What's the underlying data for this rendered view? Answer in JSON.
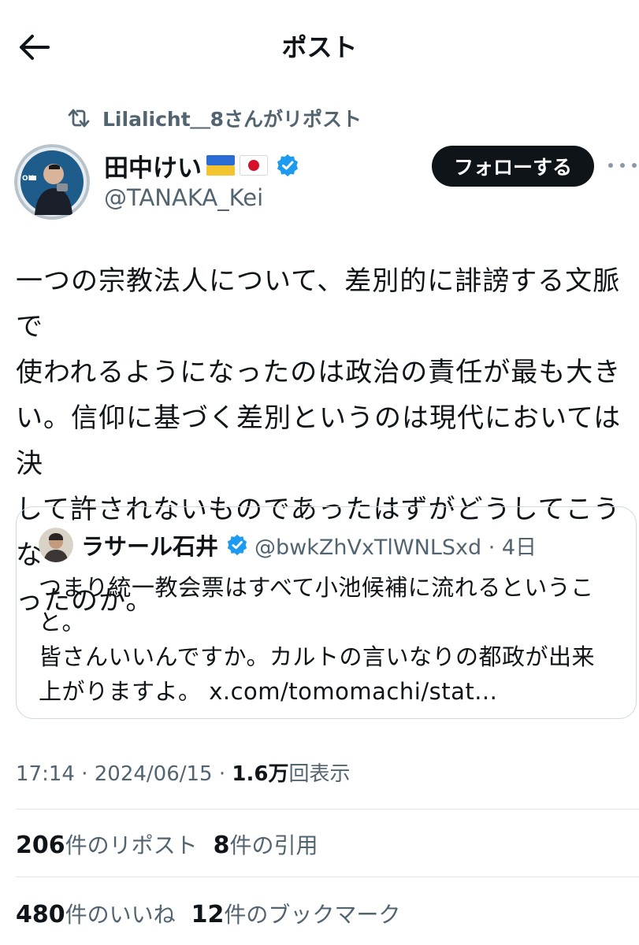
{
  "header": {
    "title": "ポスト"
  },
  "repost": {
    "text": "Lilalicht＿8さんがリポスト"
  },
  "author": {
    "name": "田中けい",
    "handle": "@TANAKA_Kei",
    "follow_label": "フォローする"
  },
  "tweet": {
    "text": "一つの宗教法人について、差別的に誹謗する文脈で\n使われるようになったのは政治の責任が最も大き\nい。信仰に基づく差別というのは現代においては決\nして許されないものであったはずがどうしてこうな\nったのか。"
  },
  "quote": {
    "name": "ラサール石井",
    "handle_time": "@bwkZhVxTlWNLSxd · 4日",
    "text": "つまり統一教会票はすべて小池候補に流れるというこ\nと。\n皆さんいいんですか。カルトの言いなりの都政が出来\n上がりますよ。 x.com/tomomachi/stat..."
  },
  "meta": {
    "time": "17:14",
    "date": "2024/06/15",
    "views": "1.6万",
    "views_label": "回表示"
  },
  "stats": {
    "reposts": "206",
    "reposts_label": "件のリポスト",
    "quotes": "8",
    "quotes_label": "件の引用",
    "likes": "480",
    "likes_label": "件のいいね",
    "bookmarks": "12",
    "bookmarks_label": "件のブックマーク"
  },
  "colors": {
    "verified": "#1d9bf0",
    "secondary_text": "#536471",
    "primary_text": "#0f1419"
  }
}
